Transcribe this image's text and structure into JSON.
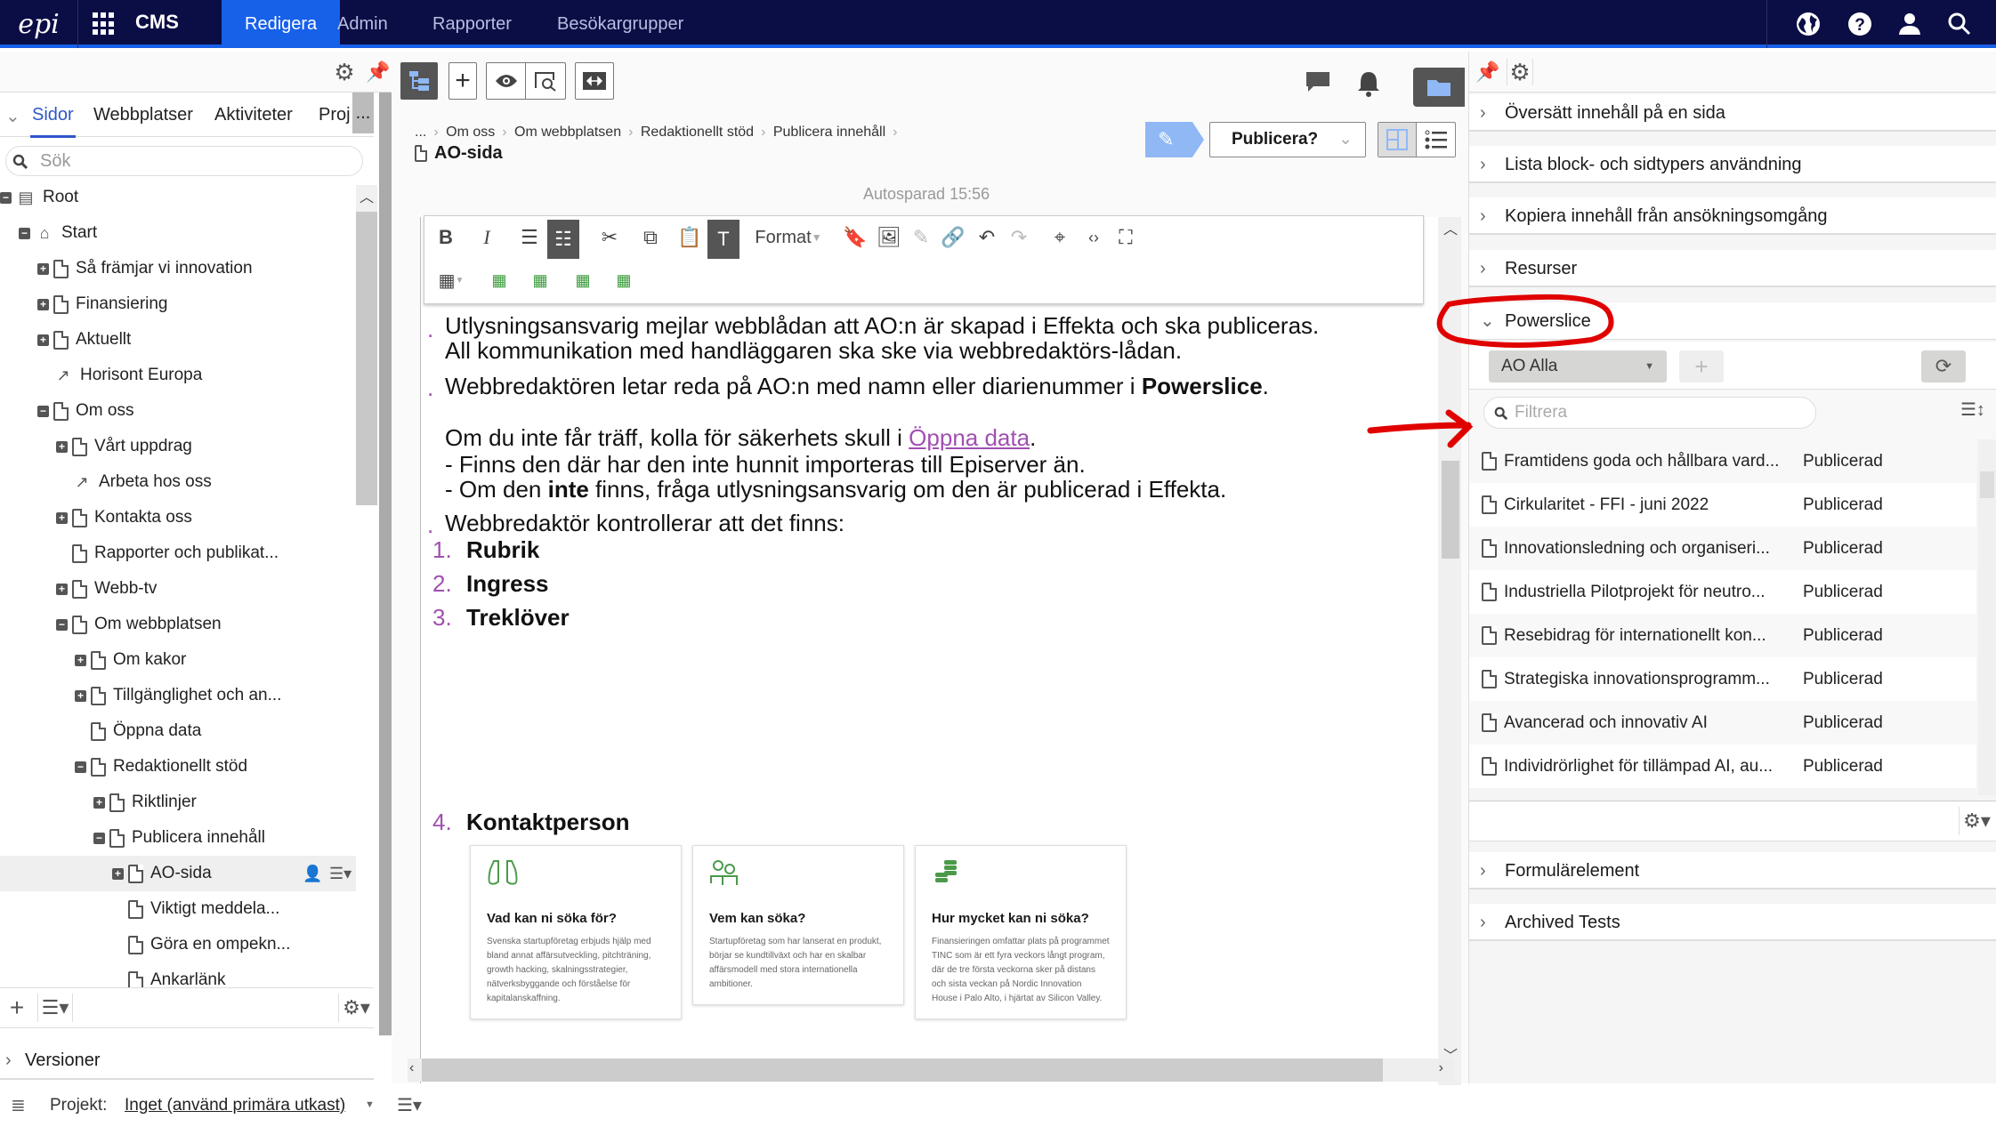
{
  "topbar": {
    "logo": "epi",
    "product": "CMS",
    "nav": [
      "Redigera",
      "Admin",
      "Rapporter",
      "Besökargrupper"
    ],
    "active_nav": "Redigera",
    "icons": [
      "globe-icon",
      "help-icon",
      "user-icon",
      "search-icon"
    ]
  },
  "left_pane": {
    "tabs": [
      "Sidor",
      "Webbplatser",
      "Aktiviteter",
      "Proj"
    ],
    "active_tab": "Sidor",
    "more": "...",
    "search_placeholder": "Sök",
    "tree": [
      {
        "label": "Root",
        "level": 0,
        "toggle": "minus",
        "icon": "root"
      },
      {
        "label": "Start",
        "level": 1,
        "toggle": "minus",
        "icon": "home"
      },
      {
        "label": "Så främjar vi innovation",
        "level": 2,
        "toggle": "plus",
        "icon": "page"
      },
      {
        "label": "Finansiering",
        "level": 2,
        "toggle": "plus",
        "icon": "page"
      },
      {
        "label": "Aktuellt",
        "level": 2,
        "toggle": "plus",
        "icon": "page"
      },
      {
        "label": "Horisont Europa",
        "level": 2,
        "toggle": "none",
        "icon": "link"
      },
      {
        "label": "Om oss",
        "level": 2,
        "toggle": "minus",
        "icon": "page"
      },
      {
        "label": "Vårt uppdrag",
        "level": 3,
        "toggle": "plus",
        "icon": "page"
      },
      {
        "label": "Arbeta hos oss",
        "level": 3,
        "toggle": "none",
        "icon": "link"
      },
      {
        "label": "Kontakta oss",
        "level": 3,
        "toggle": "plus",
        "icon": "page"
      },
      {
        "label": "Rapporter och publikat...",
        "level": 3,
        "toggle": "none",
        "icon": "page"
      },
      {
        "label": "Webb-tv",
        "level": 3,
        "toggle": "plus",
        "icon": "page"
      },
      {
        "label": "Om webbplatsen",
        "level": 3,
        "toggle": "minus",
        "icon": "page"
      },
      {
        "label": "Om kakor",
        "level": 4,
        "toggle": "plus",
        "icon": "page"
      },
      {
        "label": "Tillgänglighet och an...",
        "level": 4,
        "toggle": "plus",
        "icon": "page"
      },
      {
        "label": "Öppna data",
        "level": 4,
        "toggle": "none",
        "icon": "page"
      },
      {
        "label": "Redaktionellt stöd",
        "level": 4,
        "toggle": "minus",
        "icon": "page"
      },
      {
        "label": "Riktlinjer",
        "level": 5,
        "toggle": "plus",
        "icon": "page"
      },
      {
        "label": "Publicera innehåll",
        "level": 5,
        "toggle": "minus",
        "icon": "page"
      },
      {
        "label": "AO-sida",
        "level": 6,
        "toggle": "plus",
        "icon": "page",
        "selected": true
      },
      {
        "label": "Viktigt meddela...",
        "level": 6,
        "toggle": "none",
        "icon": "page"
      },
      {
        "label": "Göra en ompekn...",
        "level": 6,
        "toggle": "none",
        "icon": "page"
      },
      {
        "label": "Ankarlänk",
        "level": 6,
        "toggle": "none",
        "icon": "page"
      }
    ],
    "versions_label": "Versioner"
  },
  "footer": {
    "project_label": "Projekt:",
    "project_value": "Inget (använd primära utkast)"
  },
  "editor": {
    "breadcrumb": [
      "...",
      "Om oss",
      "Om webbplatsen",
      "Redaktionellt stöd",
      "Publicera innehåll"
    ],
    "page_title": "AO-sida",
    "publish_button": "Publicera?",
    "autosave": "Autosparad 15:56",
    "format_label": "Format",
    "content": {
      "p1a": "Utlysningsansvarig mejlar webblådan att AO:n är skapad i Effekta och ska publiceras.",
      "p1b": "All kommunikation med handläggaren ska ske via webbredaktörs-lådan.",
      "p2_pre": "Webbredaktören letar reda på AO:n med namn eller diarienummer i ",
      "p2_bold": "Powerslice",
      "p2_post": ".",
      "p3_pre": "Om du inte får träff, kolla för säkerhets skull i ",
      "p3_link": "Öppna data",
      "p3_post": ".",
      "p4": "- Finns den där har den inte hunnit importeras till Episerver än.",
      "p5_pre": "- Om den ",
      "p5_bold": "inte",
      "p5_post": " finns, fråga utlysningsansvarig om den är publicerad i Effekta.",
      "p6": "Webbredaktör kontrollerar att det finns:",
      "list": [
        {
          "n": "1.",
          "t": "Rubrik"
        },
        {
          "n": "2.",
          "t": "Ingress"
        },
        {
          "n": "3.",
          "t": "Treklöver"
        },
        {
          "n": "4.",
          "t": "Kontaktperson"
        }
      ],
      "cards": [
        {
          "title": "Vad kan ni söka för?",
          "body": "Svenska startupföretag erbjuds hjälp med bland annat affärsutveckling, pitchträning, growth hacking, skalningsstrategier, nätverksbyggande och förståelse för kapitalanskaffning."
        },
        {
          "title": "Vem kan söka?",
          "body": "Startupföretag som har lanserat en produkt, börjar se kundtillväxt och har en skalbar affärsmodell med stora internationella ambitioner."
        },
        {
          "title": "Hur mycket kan ni söka?",
          "body": "Finansieringen omfattar plats på programmet TINC som är ett fyra veckors långt program, där de tre första veckorna sker på distans och sista veckan på Nordic Innovation House i Palo Alto, i hjärtat av Silicon Valley."
        }
      ]
    }
  },
  "right_pane": {
    "accordions_top": [
      "Översätt innehåll på en sida",
      "Lista block- och sidtypers användning",
      "Kopiera innehåll från ansökningsomgång",
      "Resurser"
    ],
    "powerslice": {
      "title": "Powerslice",
      "slice_select": "AO Alla",
      "filter_placeholder": "Filtrera",
      "rows": [
        {
          "name": "Framtidens goda och hållbara vard...",
          "status": "Publicerad"
        },
        {
          "name": "Cirkularitet - FFI - juni 2022",
          "status": "Publicerad"
        },
        {
          "name": "Innovationsledning och organiseri...",
          "status": "Publicerad"
        },
        {
          "name": "Industriella Pilotprojekt för neutro...",
          "status": "Publicerad"
        },
        {
          "name": "Resebidrag för internationellt kon...",
          "status": "Publicerad"
        },
        {
          "name": "Strategiska innovationsprogramm...",
          "status": "Publicerad"
        },
        {
          "name": "Avancerad och innovativ AI",
          "status": "Publicerad"
        },
        {
          "name": "Individrörlighet för tillämpad AI, au...",
          "status": "Publicerad"
        }
      ]
    },
    "accordions_bottom": [
      "Formulärelement",
      "Archived Tests"
    ]
  },
  "colors": {
    "topbar": "#0b0d45",
    "accent": "#1760e8",
    "list_marker": "#a050b0",
    "annotation": "#e00000"
  }
}
